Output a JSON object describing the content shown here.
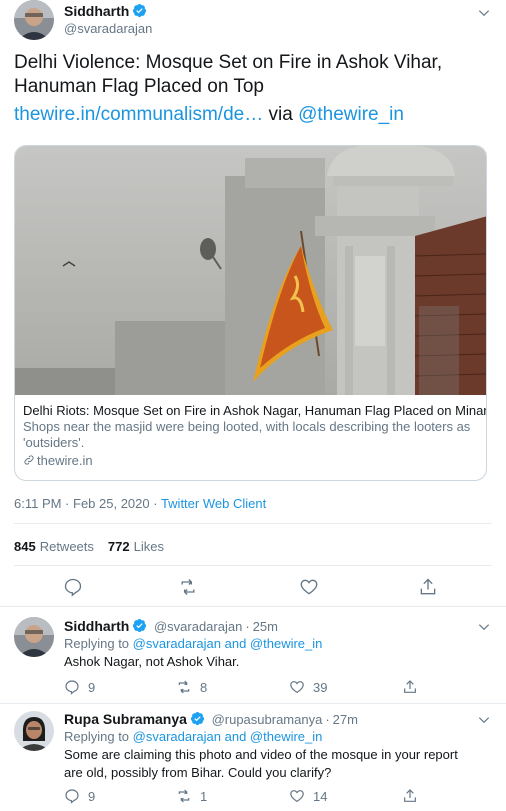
{
  "tweet": {
    "author_name": "Siddharth",
    "author_handle": "@svaradarajan",
    "text_line1": "Delhi Violence: Mosque Set on Fire in Ashok Vihar,",
    "text_line2": "Hanuman Flag Placed on Top",
    "url_text": "thewire.in/communalism/de…",
    "via_text": " via ",
    "mention": "@thewire_in",
    "card": {
      "title": "Delhi Riots: Mosque Set on Fire in Ashok Nagar, Hanuman Flag Placed on Minaret",
      "description": "Shops near the masjid were being looted, with locals describing the looters as 'outsiders'.",
      "domain": "thewire.in"
    },
    "timestamp": "6:11 PM · Feb 25, 2020 · ",
    "client": "Twitter Web Client",
    "retweets_count": "845",
    "retweets_label": "Retweets",
    "likes_count": "772",
    "likes_label": "Likes"
  },
  "replies": [
    {
      "name": "Siddharth",
      "handle": "@svaradarajan",
      "time": "25m",
      "replying_prefix": "Replying to ",
      "replying_to": "@svaradarajan and @thewire_in",
      "text": "Ashok Nagar, not Ashok Vihar.",
      "reply_count": "9",
      "retweet_count": "8",
      "like_count": "39"
    },
    {
      "name": "Rupa Subramanya",
      "handle": "@rupasubramanya",
      "time": "27m",
      "replying_prefix": "Replying to ",
      "replying_to": "@svaradarajan and @thewire_in",
      "text": "Some are claiming this photo and video of the mosque in your report are old, possibly from Bihar. Could you clarify?",
      "reply_count": "9",
      "retweet_count": "1",
      "like_count": "14"
    }
  ],
  "colors": {
    "accent": "#1b95e0",
    "muted": "#657786",
    "border": "#e6ecf0",
    "flag": "#e8a01f"
  },
  "icons": [
    "verified-badge-icon",
    "chevron-down-icon",
    "reply-icon",
    "retweet-icon",
    "like-icon",
    "share-icon",
    "link-icon"
  ]
}
